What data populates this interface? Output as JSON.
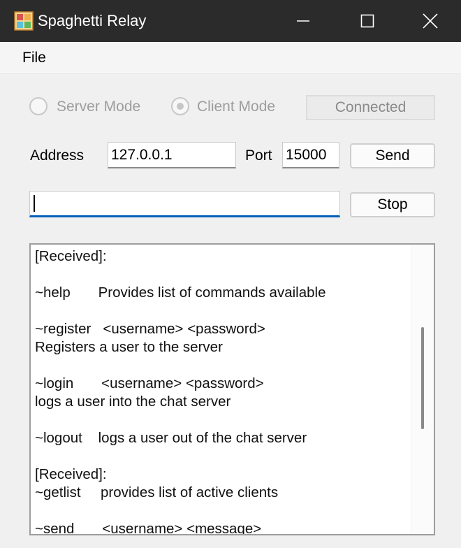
{
  "window": {
    "title": "Spaghetti Relay"
  },
  "menu": {
    "file": "File"
  },
  "mode": {
    "server_label": "Server Mode",
    "client_label": "Client Mode",
    "selected": "client",
    "status": "Connected"
  },
  "connection": {
    "address_label": "Address",
    "address_value": "127.0.0.1",
    "port_label": "Port",
    "port_value": "15000",
    "send_label": "Send"
  },
  "message": {
    "value": "",
    "stop_label": "Stop"
  },
  "log": {
    "lines": [
      "[Received]:",
      "",
      "~help       Provides list of commands available",
      "",
      "~register   <username> <password>",
      "Registers a user to the server",
      "",
      "~login       <username> <password>",
      "logs a user into the chat server",
      "",
      "~logout    logs a user out of the chat server",
      "",
      "[Received]:",
      "~getlist     provides list of active clients",
      "",
      "~send       <username> <message>"
    ]
  }
}
